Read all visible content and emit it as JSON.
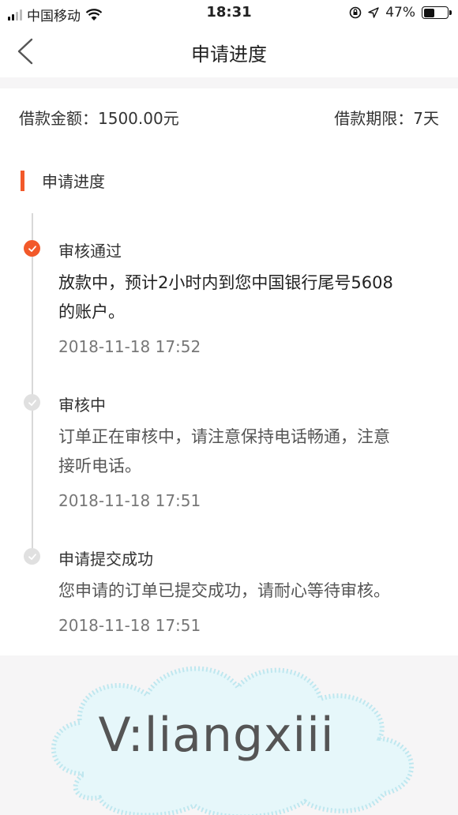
{
  "status_bar": {
    "carrier": "中国移动",
    "time": "18:31",
    "battery_percent": "47%",
    "battery_level": 0.47,
    "icons": [
      "signal-icon",
      "wifi-icon",
      "orientation-lock-icon",
      "location-icon",
      "battery-icon"
    ]
  },
  "nav": {
    "title": "申请进度",
    "back_icon": "chevron-left-icon"
  },
  "loan": {
    "amount_label": "借款金额：1500.00元",
    "term_label": "借款期限：7天"
  },
  "section": {
    "title": "申请进度"
  },
  "steps": [
    {
      "title": "审核通过",
      "desc_line1": "放款中，预计2小时内到您中国银行尾号5608",
      "desc_line2": "的账户。",
      "time": "2018-11-18 17:52",
      "state": "done"
    },
    {
      "title": "审核中",
      "desc_line1": "订单正在审核中，请注意保持电话畅通，注意",
      "desc_line2": "接听电话。",
      "time": "2018-11-18 17:51",
      "state": "pending"
    },
    {
      "title": "申请提交成功",
      "desc_line1": "您申请的订单已提交成功，请耐心等待审核。",
      "time": "2018-11-18 17:51",
      "state": "pending"
    }
  ],
  "watermark": {
    "text": "V:liangxiii"
  },
  "colors": {
    "accent": "#f2592a",
    "inactive_dot": "#e0e0e0",
    "background": "#f6f5f6"
  }
}
